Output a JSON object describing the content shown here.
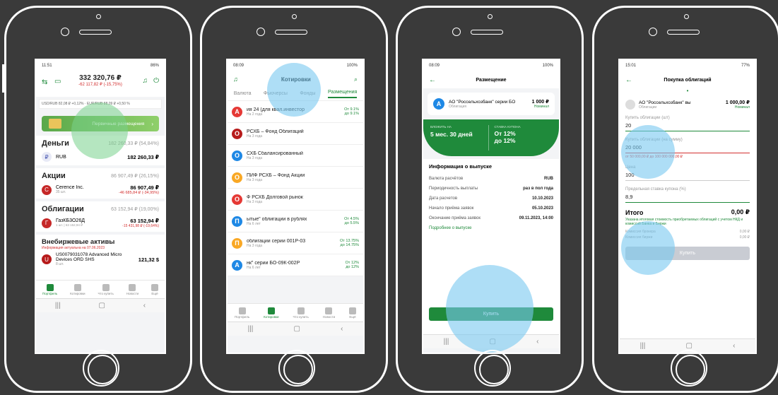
{
  "screen1": {
    "status_time": "11:51",
    "status_right": "86%",
    "total": "332 320,76 ₽",
    "total_change": "-62 117,82 ₽ (-15,75%)",
    "currency_rates": "USD/RUB 82,08 ₽ +0,12% · EUR/RUB 88,09 ₽ +0,50 %",
    "banner": "Первичные размещения",
    "money": {
      "title": "Деньги",
      "total": "182 260,33 ₽ (54,84%)",
      "item_name": "RUB",
      "item_value": "182 260,33 ₽"
    },
    "stocks": {
      "title": "Акции",
      "total": "86 907,49 ₽ (26,15%)",
      "item_name": "Cerence Inc.",
      "item_sub": "35 шт.",
      "item_value": "86 907,49 ₽",
      "item_change": "-46 685,84 ₽ (-34,95%)"
    },
    "bonds": {
      "title": "Облигации",
      "total": "63 152,94 ₽ (19,00%)",
      "item_name": "ГазКБ3О26Д",
      "item_sub": "1 шт. | 63 152,94 ₽",
      "item_value": "63 152,94 ₽",
      "item_change": "-15 431,98 ₽ (-19,64%)"
    },
    "otc": {
      "title": "Внебиржевые активы",
      "note": "Информация актуальна на 07.06.2023",
      "item_name": "US0079031078 Advanced Micro Devices ORD SHS",
      "item_sub": "8 шт.",
      "item_value": "121,32 $"
    },
    "tabs": [
      "Портфель",
      "Котировки",
      "Что купить",
      "Новости",
      "Ещё"
    ]
  },
  "screen2": {
    "status_time": "08:09",
    "status_right": "100%",
    "title": "Котировки",
    "tabs": [
      "Валюта",
      "Фьючерсы",
      "Фонды",
      "Размещения"
    ],
    "items": [
      {
        "icon": "А",
        "color": "#e53935",
        "name": "ия 24 (для квал.инвестор",
        "sub": "На 2 года",
        "y1": "От 9.1%",
        "y2": "до 9.1%"
      },
      {
        "icon": "О",
        "color": "#b71c1c",
        "name": "РСХБ – Фонд Облигаций",
        "sub": "На 3 года",
        "y1": "",
        "y2": ""
      },
      {
        "icon": "О",
        "color": "#1e88e5",
        "name": "СХБ Сбалансированный",
        "sub": "На 3 года",
        "y1": "",
        "y2": ""
      },
      {
        "icon": "О",
        "color": "#f9a825",
        "name": "ПИФ РСХБ – Фонд Акции",
        "sub": "На 3 года",
        "y1": "",
        "y2": ""
      },
      {
        "icon": "О",
        "color": "#e53935",
        "name": "Ф РСХБ Долговой рынок",
        "sub": "На 3 года",
        "y1": "",
        "y2": ""
      },
      {
        "icon": "П",
        "color": "#1e88e5",
        "name": "ытые\" облигации в рублях",
        "sub": "На 6 лет",
        "y1": "От 4.5%",
        "y2": "до 5.5%"
      },
      {
        "icon": "П",
        "color": "#f9a825",
        "name": "облигации серии 001Р-03",
        "sub": "На 3 года",
        "y1": "От 13.75%",
        "y2": "до 14.75%"
      },
      {
        "icon": "А",
        "color": "#1e88e5",
        "name": "нк\" серии БО-09К-002Р",
        "sub": "На 6 лет",
        "y1": "От 12%",
        "y2": "до 12%"
      }
    ],
    "bottom_tabs": [
      "Портфель",
      "Котировки",
      "Что купить",
      "Новости",
      "Ещё"
    ]
  },
  "screen3": {
    "status_time": "08:09",
    "status_right": "100%",
    "title": "Размещение",
    "bond_name": "АО \"Россельхозбанк\" серии БО",
    "bond_price": "1 000 ₽",
    "bond_type": "Облигация",
    "bond_nominal": "Номинал",
    "invest_label": "ВЛОЖИТЬ НА",
    "invest_value": "5 мес. 30 дней",
    "coupon_label": "СТАВКА КУПОНА",
    "coupon_from": "От 12%",
    "coupon_to": "до 12%",
    "info_title": "Информация о выпуске",
    "rows": [
      {
        "k": "Валюта расчётов",
        "v": "RUB"
      },
      {
        "k": "Периодичность выплаты",
        "v": "раз в пол года"
      },
      {
        "k": "Дата расчетов",
        "v": "10.10.2023"
      },
      {
        "k": "Начало приёма заявок",
        "v": "05.10.2023"
      },
      {
        "k": "Окончание приёма заявок",
        "v": "09.11.2023, 14:00"
      }
    ],
    "more_link": "Подробнее о выпуске",
    "buy": "Купить"
  },
  "screen4": {
    "status_time": "15:01",
    "status_right": "77%",
    "title": "Покупка облигаций",
    "bond_name": "АО \"Россельхозбанк\" вы",
    "bond_price": "1 000,00 ₽",
    "bond_type": "Облигации",
    "bond_nominal": "Номинал",
    "qty_label": "Купить облигации (шт)",
    "qty_value": "20",
    "sum_label": "Купить облигации (на сумму)",
    "sum_value": "20 000",
    "sum_hint": "от 50 000,00 ₽ до 100 000 000,00 ₽",
    "price_label": "Цена",
    "price_value": "100",
    "rate_label": "Предельная ставка купона (%)",
    "rate_value": "8,9",
    "total_label": "Итого",
    "total_value": "0,00 ₽",
    "total_note": "Указана итоговая стоимость приобретаемых облигаций с учетом НКД и комиссий Банка и Биржи",
    "broker_fee_label": "Комиссия брокера",
    "broker_fee_value": "0,00 ₽",
    "exchange_fee_label": "Комиссия биржи",
    "exchange_fee_value": "0,00 ₽",
    "buy": "Купить"
  }
}
